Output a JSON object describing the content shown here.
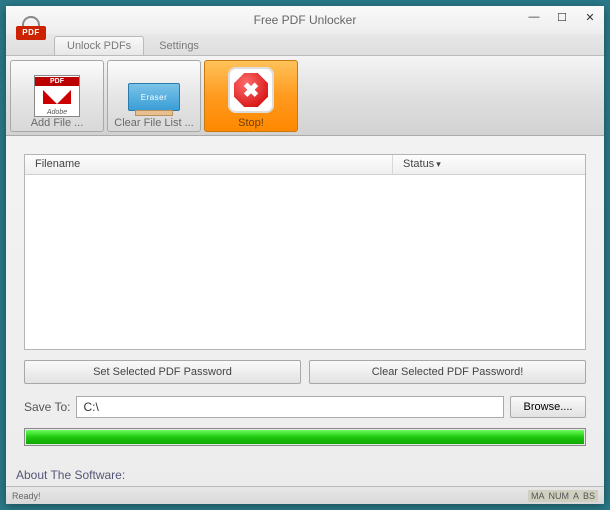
{
  "titlebar": {
    "title": "Free PDF Unlocker",
    "app_icon_text": "PDF"
  },
  "tabs": {
    "active": "Unlock PDFs",
    "inactive": "Settings"
  },
  "toolbar": {
    "add_file": {
      "label": "Add File ...",
      "pdf_badge": "PDF",
      "adobe": "Adobe"
    },
    "clear_list": {
      "label": "Clear File List ...",
      "eraser_text": "Eraser"
    },
    "stop": {
      "label": "Stop!"
    }
  },
  "list": {
    "col_filename": "Filename",
    "col_status": "Status"
  },
  "buttons": {
    "set_password": "Set Selected PDF Password",
    "clear_password": "Clear Selected PDF Password!"
  },
  "save": {
    "label": "Save To:",
    "value": "C:\\",
    "browse": "Browse...."
  },
  "progress": {
    "percent": 100
  },
  "footer": {
    "about": "About The Software:"
  },
  "statusbar": {
    "ready": "Ready!",
    "ind": [
      "MA",
      "NUM",
      "A",
      "BS"
    ]
  }
}
